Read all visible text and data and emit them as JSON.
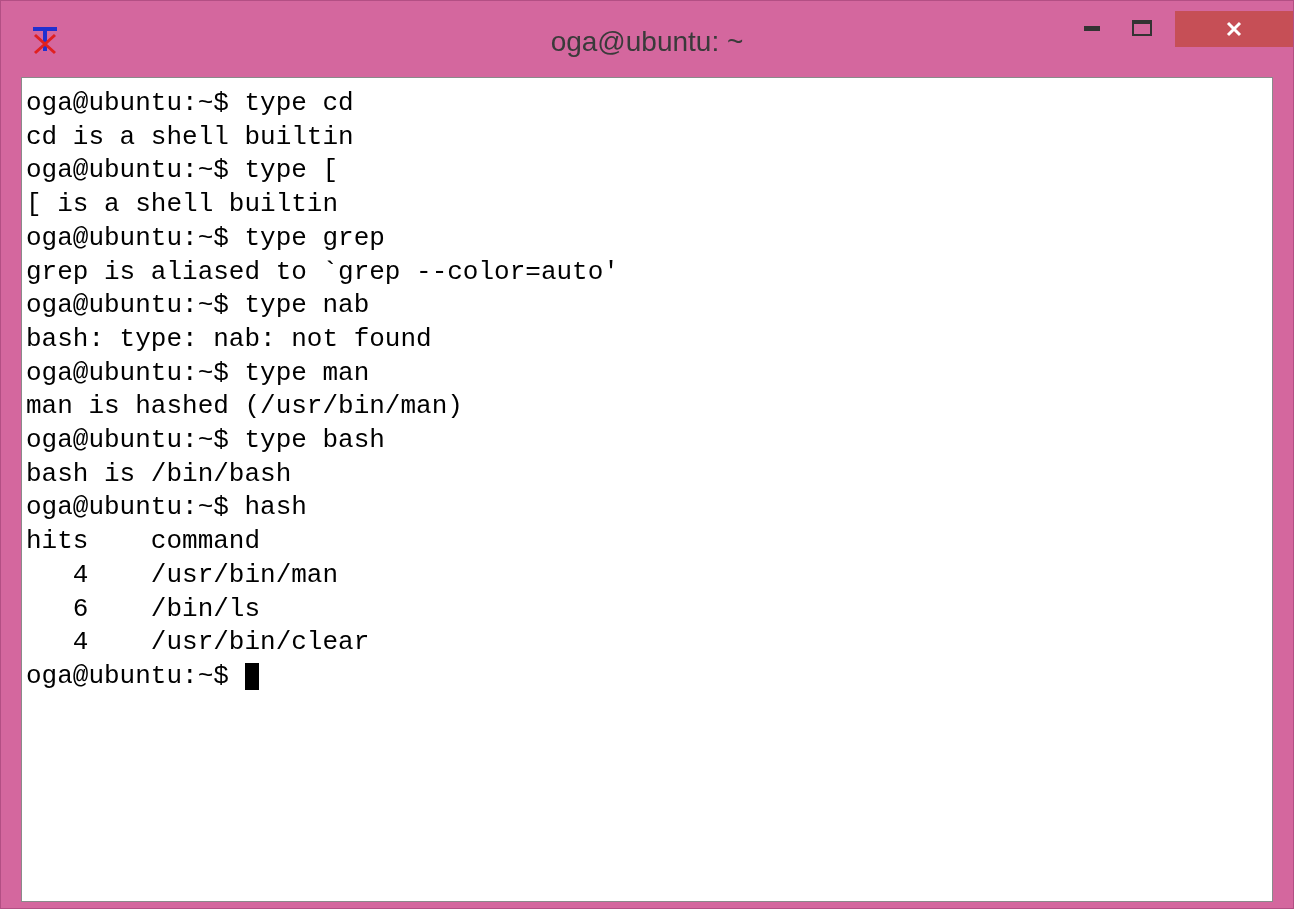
{
  "window": {
    "title": "oga@ubuntu: ~"
  },
  "terminal": {
    "lines": [
      "oga@ubuntu:~$ type cd",
      "cd is a shell builtin",
      "oga@ubuntu:~$ type [",
      "[ is a shell builtin",
      "oga@ubuntu:~$ type grep",
      "grep is aliased to `grep --color=auto'",
      "oga@ubuntu:~$ type nab",
      "bash: type: nab: not found",
      "oga@ubuntu:~$ type man",
      "man is hashed (/usr/bin/man)",
      "oga@ubuntu:~$ type bash",
      "bash is /bin/bash",
      "oga@ubuntu:~$ hash",
      "hits    command",
      "   4    /usr/bin/man",
      "   6    /bin/ls",
      "   4    /usr/bin/clear"
    ],
    "input_line": {
      "prompt": "oga@ubuntu:~$",
      "cursor": true
    }
  }
}
